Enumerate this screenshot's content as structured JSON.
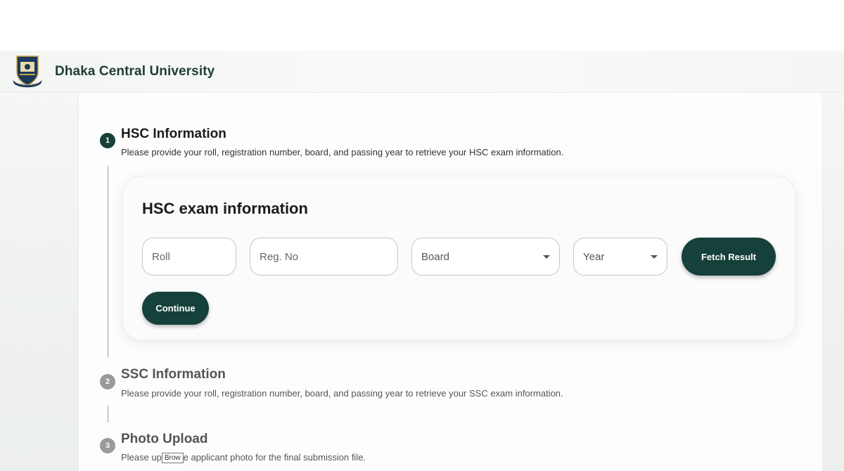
{
  "header": {
    "brand": "Dhaka Central University",
    "logo_icon": "university-crest-icon"
  },
  "steps": [
    {
      "number": "1",
      "title": "HSC Information",
      "description": "Please provide your roll, registration number, board, and passing year to retrieve your HSC exam information.",
      "state": "active"
    },
    {
      "number": "2",
      "title": "SSC Information",
      "description": "Please provide your roll, registration number, board, and passing year to retrieve your SSC exam information.",
      "state": "inactive"
    },
    {
      "number": "3",
      "title": "Photo Upload",
      "description_before": "Please up",
      "description_after": "e applicant photo for the final submission file.",
      "browse_label": "Brow",
      "state": "inactive"
    }
  ],
  "form": {
    "title": "HSC exam information",
    "roll": {
      "placeholder": "Roll",
      "value": ""
    },
    "reg_no": {
      "placeholder": "Reg. No",
      "value": ""
    },
    "board": {
      "selected": "Board"
    },
    "year": {
      "selected": "Year"
    },
    "fetch_label": "Fetch Result",
    "continue_label": "Continue"
  },
  "colors": {
    "primary": "#16403a",
    "brand_text": "#1d3d36",
    "inactive_step": "#9a9a9a"
  }
}
